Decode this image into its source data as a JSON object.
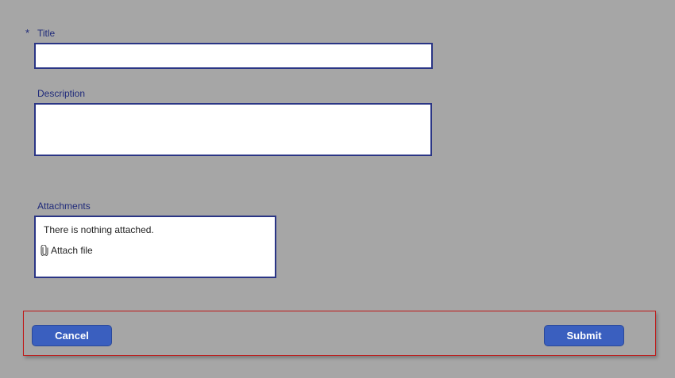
{
  "form": {
    "title_required_marker": "*",
    "title_label": "Title",
    "title_value": "",
    "description_label": "Description",
    "description_value": "",
    "attachments_label": "Attachments",
    "attachments_empty_text": "There is nothing attached.",
    "attach_file_label": "Attach file"
  },
  "actions": {
    "cancel_label": "Cancel",
    "submit_label": "Submit"
  },
  "icons": {
    "attach": "paperclip-icon"
  },
  "colors": {
    "background": "#a6a6a6",
    "label_text": "#1f2a7a",
    "field_border": "#2a3585",
    "button_bg": "#3a5fbf",
    "highlight_border": "#c01818"
  }
}
